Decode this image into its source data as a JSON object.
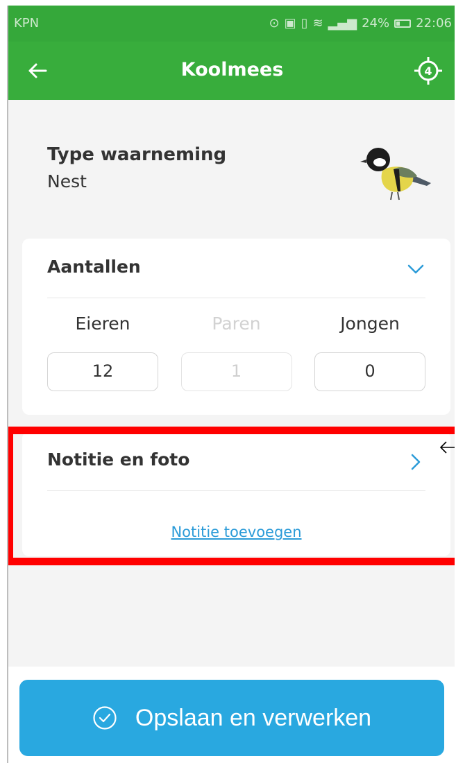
{
  "status_bar": {
    "carrier": "KPN",
    "battery": "24%",
    "time": "22:06"
  },
  "app_bar": {
    "title": "Koolmees",
    "gps_count": "4"
  },
  "observation": {
    "type_label": "Type waarneming",
    "type_value": "Nest",
    "bird_icon": "great-tit-illustration"
  },
  "counts_card": {
    "title": "Aantallen",
    "items": [
      {
        "label": "Eieren",
        "value": "12"
      },
      {
        "label": "Paren",
        "value": "1"
      },
      {
        "label": "Jongen",
        "value": "0"
      }
    ]
  },
  "notes_card": {
    "title": "Notitie en foto",
    "link": "Notitie toevoegen"
  },
  "save_button": {
    "label": "Opslaan en verwerken"
  },
  "colors": {
    "app_bar": "#38ad3c",
    "accent_blue": "#29a8e0",
    "highlight": "#ff0000"
  }
}
